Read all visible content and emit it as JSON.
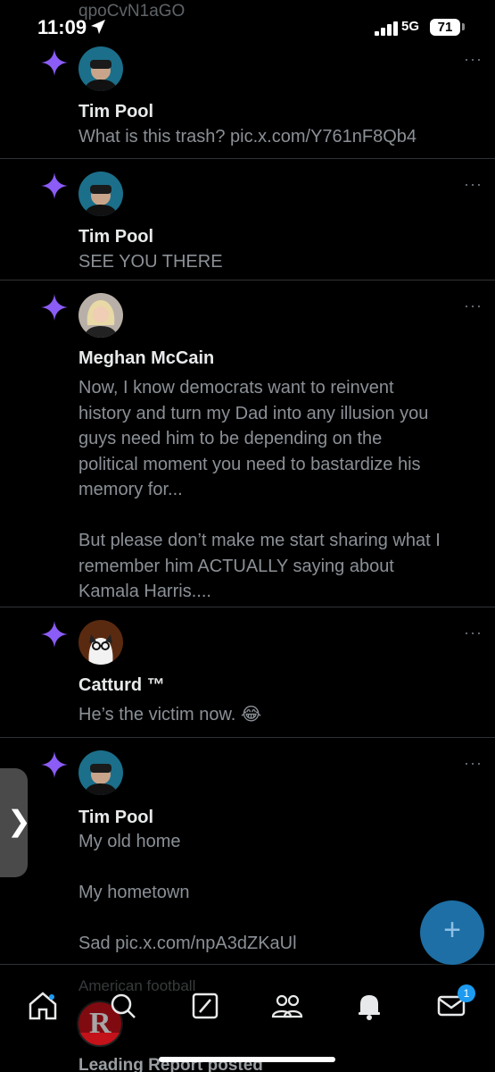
{
  "status_bar": {
    "time": "11:09",
    "network": "5G",
    "battery": "71"
  },
  "previous_snippet": "qpoCvN1aGO",
  "notifications": [
    {
      "author": "Tim Pool",
      "text": "What is this trash? pic.x.com/Y761nF8Qb4",
      "more": "···"
    },
    {
      "author": "Tim Pool",
      "text": "SEE YOU THERE",
      "more": "···"
    },
    {
      "author": "Meghan McCain",
      "text": "Now, I know democrats want to reinvent\nhistory and turn my Dad into any illusion you\nguys need him to be depending on the\npolitical moment you need to bastardize his\nmemory for...\n\nBut please don’t make me start sharing what I\nremember him ACTUALLY saying about\nKamala Harris....",
      "more": "···"
    },
    {
      "author": "Catturd ™",
      "text": "He’s the victim now. 😂",
      "more": "···"
    },
    {
      "author": "Tim Pool",
      "text": "My old home\n\nMy hometown\n\nSad pic.x.com/npA3dZKaUl",
      "more": "···"
    }
  ],
  "partial_post": {
    "topic": "American football",
    "author_line": "Leading Report posted",
    "logo_letter": "R"
  },
  "fab": {
    "label": "+"
  },
  "side_tab": {
    "label": "❯"
  },
  "tabbar": {
    "messages_badge": "1"
  },
  "colors": {
    "background": "#000000",
    "spark": "#8b5cf6",
    "accent": "#1d9bf0",
    "fab": "#1d6fa5"
  }
}
